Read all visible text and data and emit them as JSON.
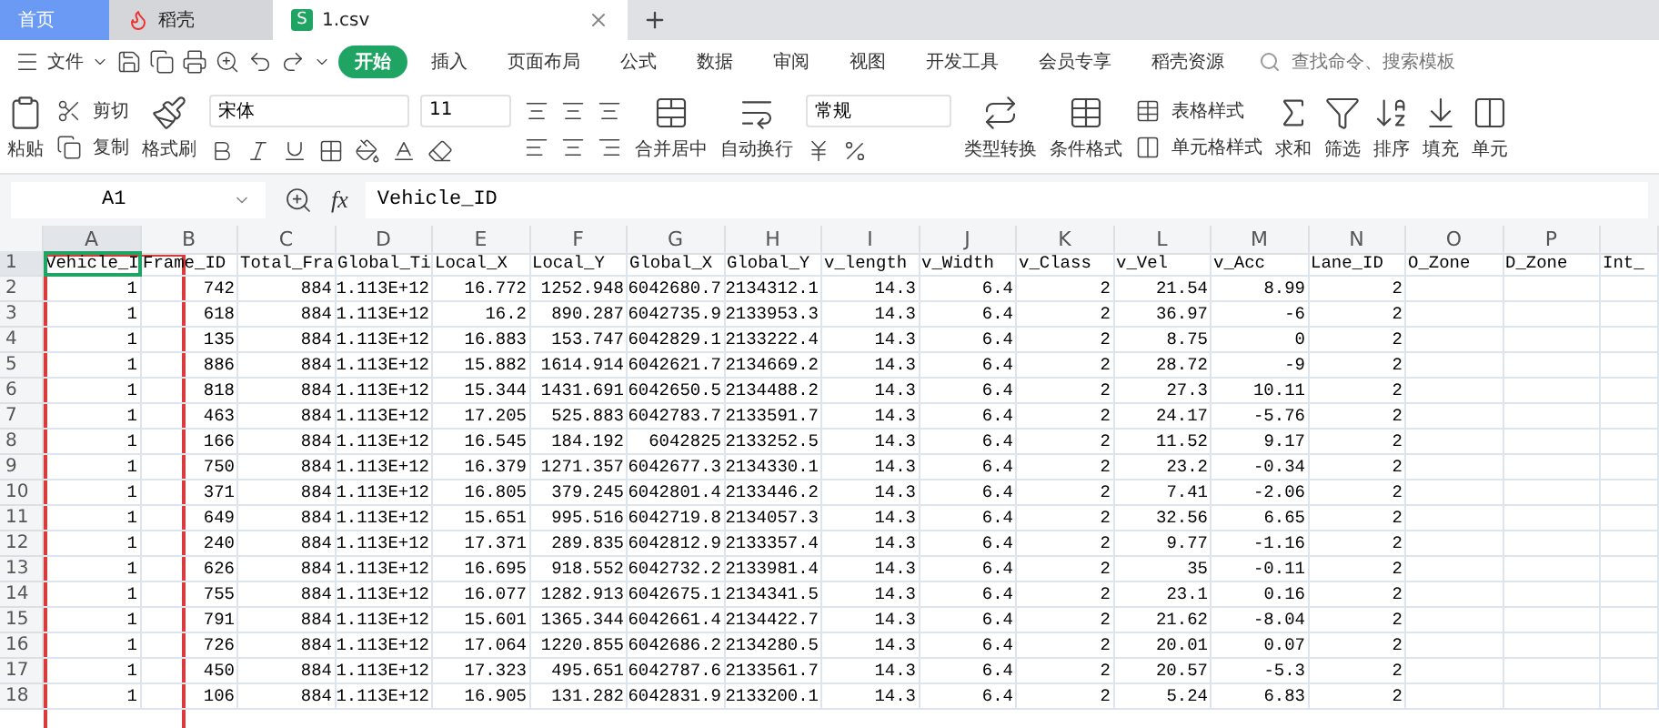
{
  "tabs": [
    {
      "label": "首页",
      "kind": "home",
      "selected": false
    },
    {
      "label": "稻壳",
      "kind": "app",
      "selected": false
    },
    {
      "label": "1.csv",
      "kind": "file",
      "badge": "S",
      "selected": true
    }
  ],
  "menu": {
    "file": "文件",
    "tabs": [
      {
        "label": "开始",
        "selected": true
      },
      {
        "label": "插入",
        "selected": false
      },
      {
        "label": "页面布局",
        "selected": false
      },
      {
        "label": "公式",
        "selected": false
      },
      {
        "label": "数据",
        "selected": false
      },
      {
        "label": "审阅",
        "selected": false
      },
      {
        "label": "视图",
        "selected": false
      },
      {
        "label": "开发工具",
        "selected": false
      },
      {
        "label": "会员专享",
        "selected": false
      },
      {
        "label": "稻壳资源",
        "selected": false
      }
    ],
    "search": {
      "placeholder": "查找命令、搜索模板"
    }
  },
  "ribbon": {
    "paste": "粘贴",
    "cut": "剪切",
    "copy": "复制",
    "format_painter": "格式刷",
    "font_name": "宋体",
    "font_size": "11",
    "merge": "合并居中",
    "wrap": "自动换行",
    "number_format": "常规",
    "convert": "类型转换",
    "conditional": "条件格式",
    "table_style": "表格样式",
    "cell_style": "单元格样式",
    "sum": "求和",
    "filter": "筛选",
    "sort": "排序",
    "fill": "填充",
    "cells": "单元"
  },
  "formula_bar": {
    "name_box": "A1",
    "fx_label": "fx",
    "formula": "Vehicle_ID"
  },
  "sheet": {
    "columns": [
      {
        "label": "A",
        "selected": true
      },
      {
        "label": "B",
        "selected": false
      },
      {
        "label": "C",
        "selected": false
      },
      {
        "label": "D",
        "selected": false
      },
      {
        "label": "E",
        "selected": false
      },
      {
        "label": "F",
        "selected": false
      },
      {
        "label": "G",
        "selected": false
      },
      {
        "label": "H",
        "selected": false
      },
      {
        "label": "I",
        "selected": false
      },
      {
        "label": "J",
        "selected": false
      },
      {
        "label": "K",
        "selected": false
      },
      {
        "label": "L",
        "selected": false
      },
      {
        "label": "M",
        "selected": false
      },
      {
        "label": "N",
        "selected": false
      },
      {
        "label": "O",
        "selected": false
      },
      {
        "label": "P",
        "selected": false
      },
      {
        "selected": false
      }
    ],
    "rows": [
      {
        "number": "1",
        "kind": "text",
        "selected": true,
        "cells": [
          "Vehicle_I",
          "Frame_ID",
          "Total_Fra",
          "Global_Ti",
          "Local_X",
          "Local_Y",
          "Global_X",
          "Global_Y",
          "v_length",
          "v_Width",
          "v_Class",
          "v_Vel",
          "v_Acc",
          "Lane_ID",
          "O_Zone",
          "D_Zone",
          "Int_"
        ]
      },
      {
        "number": "2",
        "kind": "number",
        "selected": false,
        "cells": [
          "1",
          "742",
          "884",
          "1.113E+12",
          "16.772",
          "1252.948",
          "6042680.7",
          "2134312.1",
          "14.3",
          "6.4",
          "2",
          "21.54",
          "8.99",
          "2"
        ]
      },
      {
        "number": "3",
        "kind": "number",
        "selected": false,
        "cells": [
          "1",
          "618",
          "884",
          "1.113E+12",
          "16.2",
          "890.287",
          "6042735.9",
          "2133953.3",
          "14.3",
          "6.4",
          "2",
          "36.97",
          "-6",
          "2"
        ]
      },
      {
        "number": "4",
        "kind": "number",
        "selected": false,
        "cells": [
          "1",
          "135",
          "884",
          "1.113E+12",
          "16.883",
          "153.747",
          "6042829.1",
          "2133222.4",
          "14.3",
          "6.4",
          "2",
          "8.75",
          "0",
          "2"
        ]
      },
      {
        "number": "5",
        "kind": "number",
        "selected": false,
        "cells": [
          "1",
          "886",
          "884",
          "1.113E+12",
          "15.882",
          "1614.914",
          "6042621.7",
          "2134669.2",
          "14.3",
          "6.4",
          "2",
          "28.72",
          "-9",
          "2"
        ]
      },
      {
        "number": "6",
        "kind": "number",
        "selected": false,
        "cells": [
          "1",
          "818",
          "884",
          "1.113E+12",
          "15.344",
          "1431.691",
          "6042650.5",
          "2134488.2",
          "14.3",
          "6.4",
          "2",
          "27.3",
          "10.11",
          "2"
        ]
      },
      {
        "number": "7",
        "kind": "number",
        "selected": false,
        "cells": [
          "1",
          "463",
          "884",
          "1.113E+12",
          "17.205",
          "525.883",
          "6042783.7",
          "2133591.7",
          "14.3",
          "6.4",
          "2",
          "24.17",
          "-5.76",
          "2"
        ]
      },
      {
        "number": "8",
        "kind": "number",
        "selected": false,
        "cells": [
          "1",
          "166",
          "884",
          "1.113E+12",
          "16.545",
          "184.192",
          "6042825",
          "2133252.5",
          "14.3",
          "6.4",
          "2",
          "11.52",
          "9.17",
          "2"
        ]
      },
      {
        "number": "9",
        "kind": "number",
        "selected": false,
        "cells": [
          "1",
          "750",
          "884",
          "1.113E+12",
          "16.379",
          "1271.357",
          "6042677.3",
          "2134330.1",
          "14.3",
          "6.4",
          "2",
          "23.2",
          "-0.34",
          "2"
        ]
      },
      {
        "number": "10",
        "kind": "number",
        "selected": false,
        "cells": [
          "1",
          "371",
          "884",
          "1.113E+12",
          "16.805",
          "379.245",
          "6042801.4",
          "2133446.2",
          "14.3",
          "6.4",
          "2",
          "7.41",
          "-2.06",
          "2"
        ]
      },
      {
        "number": "11",
        "kind": "number",
        "selected": false,
        "cells": [
          "1",
          "649",
          "884",
          "1.113E+12",
          "15.651",
          "995.516",
          "6042719.8",
          "2134057.3",
          "14.3",
          "6.4",
          "2",
          "32.56",
          "6.65",
          "2"
        ]
      },
      {
        "number": "12",
        "kind": "number",
        "selected": false,
        "cells": [
          "1",
          "240",
          "884",
          "1.113E+12",
          "17.371",
          "289.835",
          "6042812.9",
          "2133357.4",
          "14.3",
          "6.4",
          "2",
          "9.77",
          "-1.16",
          "2"
        ]
      },
      {
        "number": "13",
        "kind": "number",
        "selected": false,
        "cells": [
          "1",
          "626",
          "884",
          "1.113E+12",
          "16.695",
          "918.552",
          "6042732.2",
          "2133981.4",
          "14.3",
          "6.4",
          "2",
          "35",
          "-0.11",
          "2"
        ]
      },
      {
        "number": "14",
        "kind": "number",
        "selected": false,
        "cells": [
          "1",
          "755",
          "884",
          "1.113E+12",
          "16.077",
          "1282.913",
          "6042675.1",
          "2134341.5",
          "14.3",
          "6.4",
          "2",
          "23.1",
          "0.16",
          "2"
        ]
      },
      {
        "number": "15",
        "kind": "number",
        "selected": false,
        "cells": [
          "1",
          "791",
          "884",
          "1.113E+12",
          "15.601",
          "1365.344",
          "6042661.4",
          "2134422.7",
          "14.3",
          "6.4",
          "2",
          "21.62",
          "-8.04",
          "2"
        ]
      },
      {
        "number": "16",
        "kind": "number",
        "selected": false,
        "cells": [
          "1",
          "726",
          "884",
          "1.113E+12",
          "17.064",
          "1220.855",
          "6042686.2",
          "2134280.5",
          "14.3",
          "6.4",
          "2",
          "20.01",
          "0.07",
          "2"
        ]
      },
      {
        "number": "17",
        "kind": "number",
        "selected": false,
        "cells": [
          "1",
          "450",
          "884",
          "1.113E+12",
          "17.323",
          "495.651",
          "6042787.6",
          "2133561.7",
          "14.3",
          "6.4",
          "2",
          "20.57",
          "-5.3",
          "2"
        ]
      },
      {
        "number": "18",
        "kind": "number",
        "selected": false,
        "cells": [
          "1",
          "106",
          "884",
          "1.113E+12",
          "16.905",
          "131.282",
          "6042831.9",
          "2133200.1",
          "14.3",
          "6.4",
          "2",
          "5.24",
          "6.83",
          "2"
        ]
      }
    ]
  }
}
